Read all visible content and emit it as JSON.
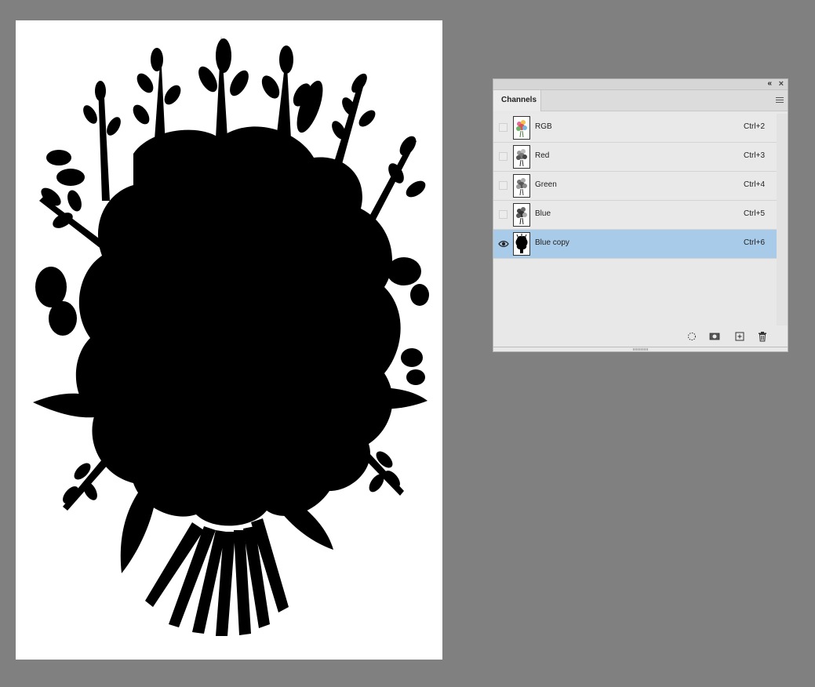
{
  "panel": {
    "tab_label": "Channels",
    "collapse_glyph": "«",
    "close_glyph": "×"
  },
  "channels": [
    {
      "name": "RGB",
      "shortcut": "Ctrl+2",
      "visible": false,
      "selected": false,
      "thumb": "color"
    },
    {
      "name": "Red",
      "shortcut": "Ctrl+3",
      "visible": false,
      "selected": false,
      "thumb": "light"
    },
    {
      "name": "Green",
      "shortcut": "Ctrl+4",
      "visible": false,
      "selected": false,
      "thumb": "mid"
    },
    {
      "name": "Blue",
      "shortcut": "Ctrl+5",
      "visible": false,
      "selected": false,
      "thumb": "dark"
    },
    {
      "name": "Blue copy",
      "shortcut": "Ctrl+6",
      "visible": true,
      "selected": true,
      "thumb": "silhouette"
    }
  ],
  "footer_icons": [
    "load-selection-icon",
    "save-selection-icon",
    "new-channel-icon",
    "delete-channel-icon"
  ],
  "colors": {
    "workspace": "#808080",
    "selected_row": "#a9cbea",
    "panel_bg": "#e8e8e8"
  }
}
